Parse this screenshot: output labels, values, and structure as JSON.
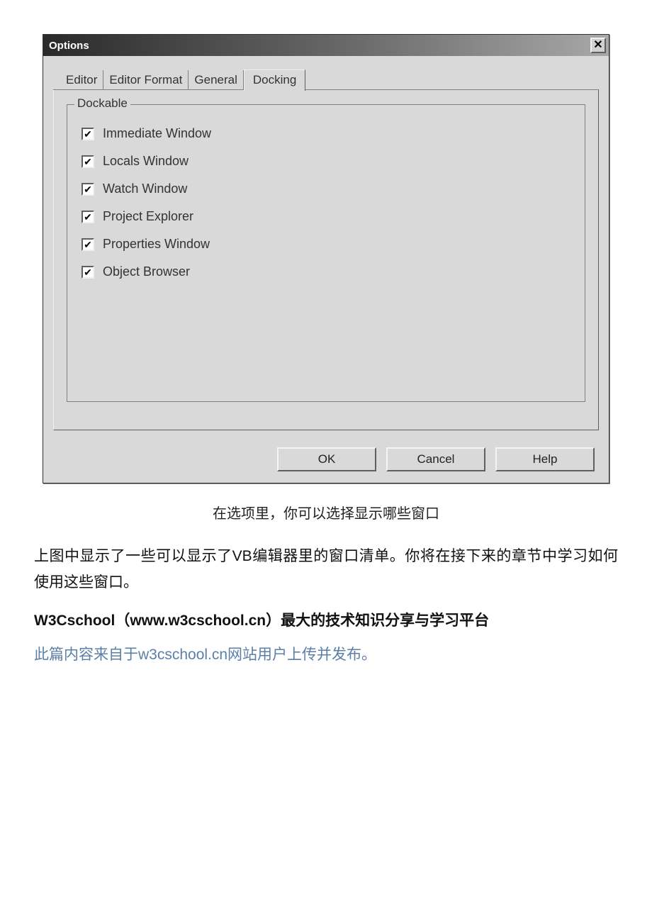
{
  "dialog": {
    "title": "Options",
    "close_glyph": "✕",
    "tabs": [
      "Editor",
      "Editor Format",
      "General",
      "Docking"
    ],
    "active_tab_index": 3,
    "groupbox_label": "Dockable",
    "checkboxes": [
      {
        "label": "Immediate Window",
        "checked": true
      },
      {
        "label": "Locals Window",
        "checked": true
      },
      {
        "label": "Watch Window",
        "checked": true
      },
      {
        "label": "Project Explorer",
        "checked": true
      },
      {
        "label": "Properties Window",
        "checked": true
      },
      {
        "label": "Object Browser",
        "checked": true
      }
    ],
    "buttons": {
      "ok": "OK",
      "cancel": "Cancel",
      "help": "Help"
    }
  },
  "caption": "在选项里，你可以选择显示哪些窗口",
  "paragraph": "上图中显示了一些可以显示了VB编辑器里的窗口清单。你将在接下来的章节中学习如何使用这些窗口。",
  "bold_line": "W3Cschool（www.w3cschool.cn）最大的技术知识分享与学习平台",
  "link_line": "此篇内容来自于w3cschool.cn网站用户上传并发布。"
}
